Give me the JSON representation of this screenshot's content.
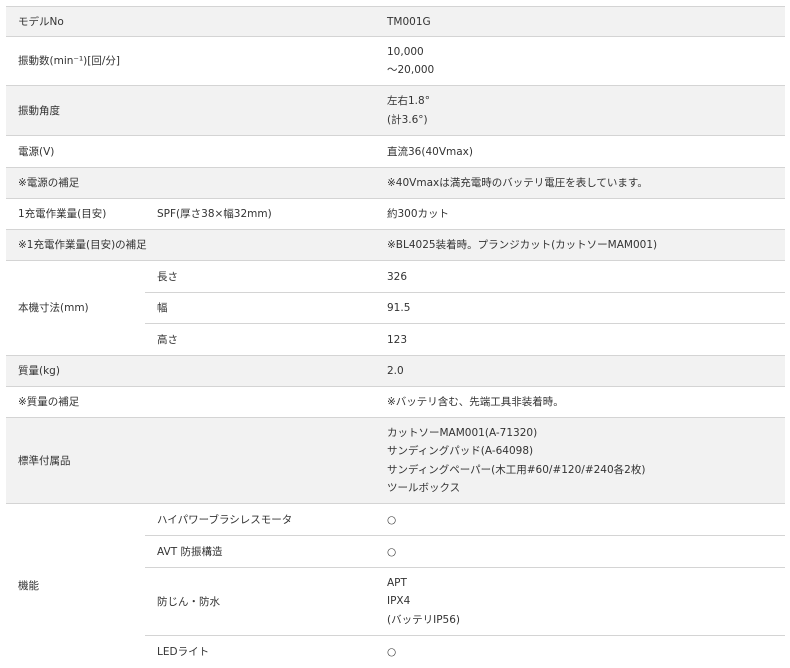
{
  "rows": {
    "model": {
      "label": "モデルNo",
      "value": "TM001G"
    },
    "vibration": {
      "label": "振動数(min⁻¹)[回/分]",
      "value_lines": [
        "10,000",
        "～20,000"
      ]
    },
    "angle": {
      "label": "振動角度",
      "value_lines": [
        "左右1.8°",
        "(計3.6°)"
      ]
    },
    "power": {
      "label": "電源(V)",
      "value": "直流36(40Vmax)"
    },
    "power_note": {
      "label": "※電源の補足",
      "value": "※40Vmaxは満充電時のバッテリ電圧を表しています。"
    },
    "work": {
      "label": "1充電作業量(目安)",
      "sub": "SPF(厚さ38×幅32mm)",
      "value": "約300カット"
    },
    "work_note": {
      "label": "※1充電作業量(目安)の補足",
      "value": "※BL4025装着時。プランジカット(カットソーMAM001)"
    },
    "dimensions": {
      "label": "本機寸法(mm)",
      "items": [
        {
          "sub": "長さ",
          "value": "326"
        },
        {
          "sub": "幅",
          "value": "91.5"
        },
        {
          "sub": "高さ",
          "value": "123"
        }
      ]
    },
    "mass": {
      "label": "質量(kg)",
      "value": "2.0"
    },
    "mass_note": {
      "label": "※質量の補足",
      "value": "※バッテリ含む、先端工具非装着時。"
    },
    "accessories": {
      "label": "標準付属品",
      "value_lines": [
        "カットソーMAM001(A-71320)",
        "サンディングパッド(A-64098)",
        "サンディングペーパー(木工用#60/#120/#240各2枚)",
        "ツールボックス"
      ]
    },
    "features": {
      "label": "機能",
      "items": [
        {
          "sub": "ハイパワーブラシレスモータ",
          "value": "○"
        },
        {
          "sub": "AVT 防振構造",
          "value": "○"
        },
        {
          "sub": "防じん・防水",
          "value_lines": [
            "APT",
            "IPX4",
            "(バッテリIP56)"
          ]
        },
        {
          "sub": "LEDライト",
          "value": "○"
        }
      ]
    }
  }
}
